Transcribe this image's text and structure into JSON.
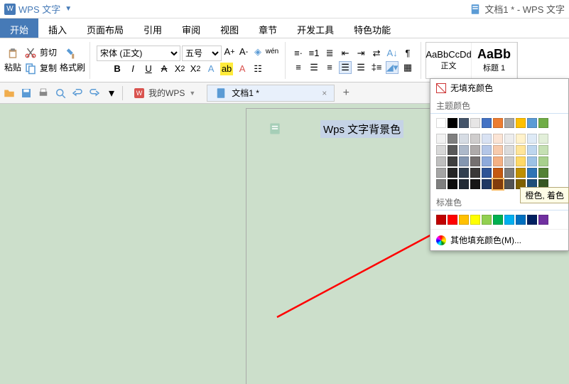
{
  "app": {
    "name": "WPS 文字",
    "doc_title": "文档1 * - WPS 文字"
  },
  "menus": {
    "start": "开始",
    "insert": "插入",
    "layout": "页面布局",
    "ref": "引用",
    "review": "审阅",
    "view": "视图",
    "chapter": "章节",
    "dev": "开发工具",
    "special": "特色功能"
  },
  "ribbon": {
    "paste": "粘贴",
    "cut": "剪切",
    "copy": "复制",
    "brush": "格式刷",
    "font": "宋体 (正文)",
    "size": "五号",
    "style_normal_sample": "AaBbCcDd",
    "style_normal": "正文",
    "style_h1_sample": "AaBb",
    "style_h1": "标题 1"
  },
  "tabs": {
    "wps_home": "我的WPS",
    "doc1": "文档1 *"
  },
  "document": {
    "selected_text": "Wps 文字背景色"
  },
  "color_popup": {
    "no_fill": "无填充颜色",
    "theme_label": "主题颜色",
    "standard_label": "标准色",
    "more_label": "其他填充颜色(M)...",
    "theme_row0": [
      "#ffffff",
      "#000000",
      "#44546a",
      "#e7e6e6",
      "#4472c4",
      "#ed7d31",
      "#a5a5a5",
      "#ffc000",
      "#5b9bd5",
      "#70ad47"
    ],
    "theme_shades": [
      [
        "#f2f2f2",
        "#7f7f7f",
        "#d6dce4",
        "#cfcdcd",
        "#d9e2f3",
        "#fbe4d5",
        "#ededed",
        "#fff2cc",
        "#deeaf6",
        "#e2efd9"
      ],
      [
        "#d8d8d8",
        "#595959",
        "#adb9ca",
        "#aeaaaa",
        "#b4c6e7",
        "#f7caac",
        "#dbdbdb",
        "#ffe599",
        "#bdd6ee",
        "#c5e0b3"
      ],
      [
        "#bfbfbf",
        "#3f3f3f",
        "#8496b0",
        "#757070",
        "#8eaadb",
        "#f4b083",
        "#c9c9c9",
        "#ffd966",
        "#9cc2e5",
        "#a8d08d"
      ],
      [
        "#a5a5a5",
        "#262626",
        "#323f4f",
        "#3a3838",
        "#2f5496",
        "#c45911",
        "#7b7b7b",
        "#bf8f00",
        "#2e74b5",
        "#538135"
      ],
      [
        "#7f7f7f",
        "#0c0c0c",
        "#222a35",
        "#171616",
        "#1f3864",
        "#833c0b",
        "#525252",
        "#7f6000",
        "#1f4e79",
        "#375623"
      ]
    ],
    "standard": [
      "#c00000",
      "#ff0000",
      "#ffc000",
      "#ffff00",
      "#92d050",
      "#00b050",
      "#00b0f0",
      "#0070c0",
      "#002060",
      "#7030a0"
    ]
  },
  "tooltip": "橙色, 着色"
}
